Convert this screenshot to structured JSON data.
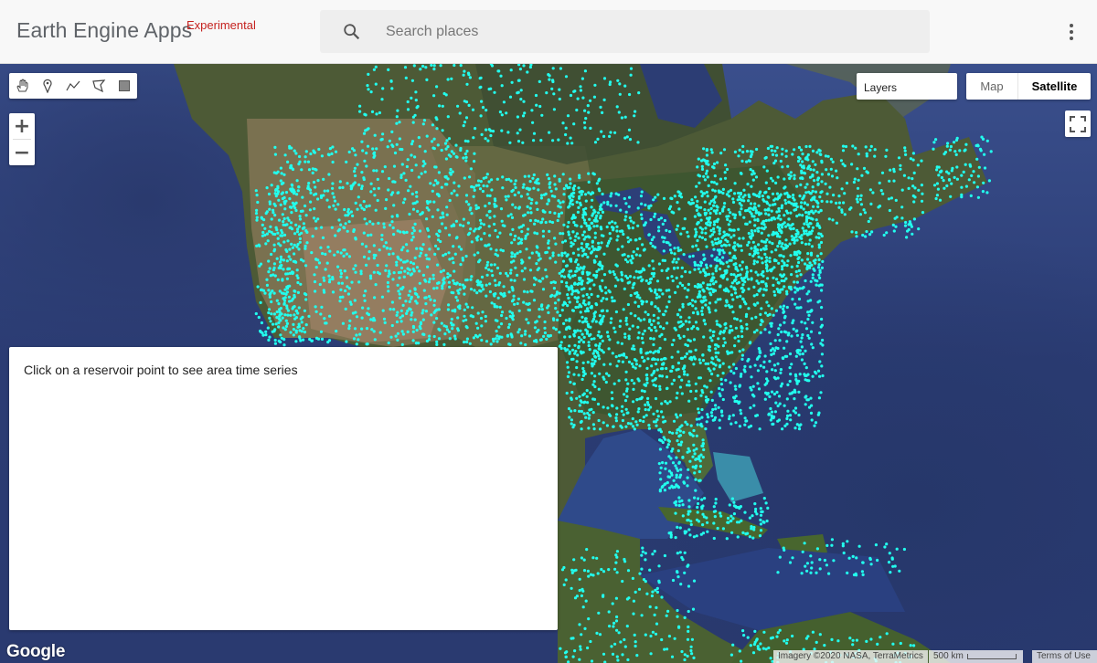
{
  "header": {
    "brand": "Earth Engine Apps",
    "brand_tag": "Experimental",
    "search_placeholder": "Search places"
  },
  "map": {
    "layers_label": "Layers",
    "map_type_options": [
      "Map",
      "Satellite"
    ],
    "selected_map_type": "Satellite",
    "zoom_in": "+",
    "zoom_out": "−",
    "point_color": "#22ffee",
    "ocean_color": "#2b3c74"
  },
  "panel": {
    "message": "Click on a reservoir point to see area time series"
  },
  "footer": {
    "logo": "Google",
    "attribution": "Imagery ©2020 NASA, TerraMetrics",
    "scale": "500 km",
    "terms": "Terms of Use"
  },
  "icons": [
    "search-icon",
    "more-vert-icon",
    "pan-hand-icon",
    "marker-icon",
    "line-icon",
    "polygon-icon",
    "rectangle-icon",
    "fullscreen-icon"
  ]
}
